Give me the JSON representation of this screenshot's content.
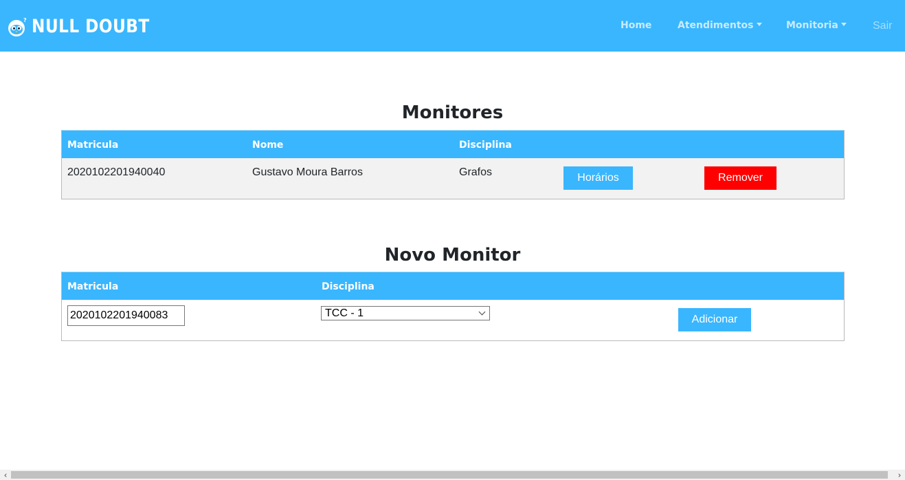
{
  "navbar": {
    "brand": "NULL DOUBT",
    "items": [
      {
        "label": "Home"
      },
      {
        "label": "Atendimentos"
      },
      {
        "label": "Monitoria"
      },
      {
        "label": "Sair"
      }
    ],
    "color": "#39b6fe"
  },
  "monitores": {
    "title": "Monitores",
    "headers": [
      "Matricula",
      "Nome",
      "Disciplina"
    ],
    "rows": [
      {
        "matricula": "2020102201940040",
        "nome": "Gustavo Moura Barros",
        "disciplina": "Grafos",
        "horarios_label": "Horários",
        "remover_label": "Remover"
      }
    ]
  },
  "novo_monitor": {
    "title": "Novo Monitor",
    "headers": [
      "Matricula",
      "Disciplina"
    ],
    "matricula_value": "2020102201940083",
    "disciplina_selected": "TCC - 1",
    "adicionar_label": "Adicionar"
  },
  "colors": {
    "accent": "#39b6fe",
    "danger": "#ff0000",
    "row_bg": "#f2f2f2"
  },
  "scrollbar": {
    "left_icon": "chevron-left-icon",
    "right_icon": "chevron-right-icon"
  }
}
